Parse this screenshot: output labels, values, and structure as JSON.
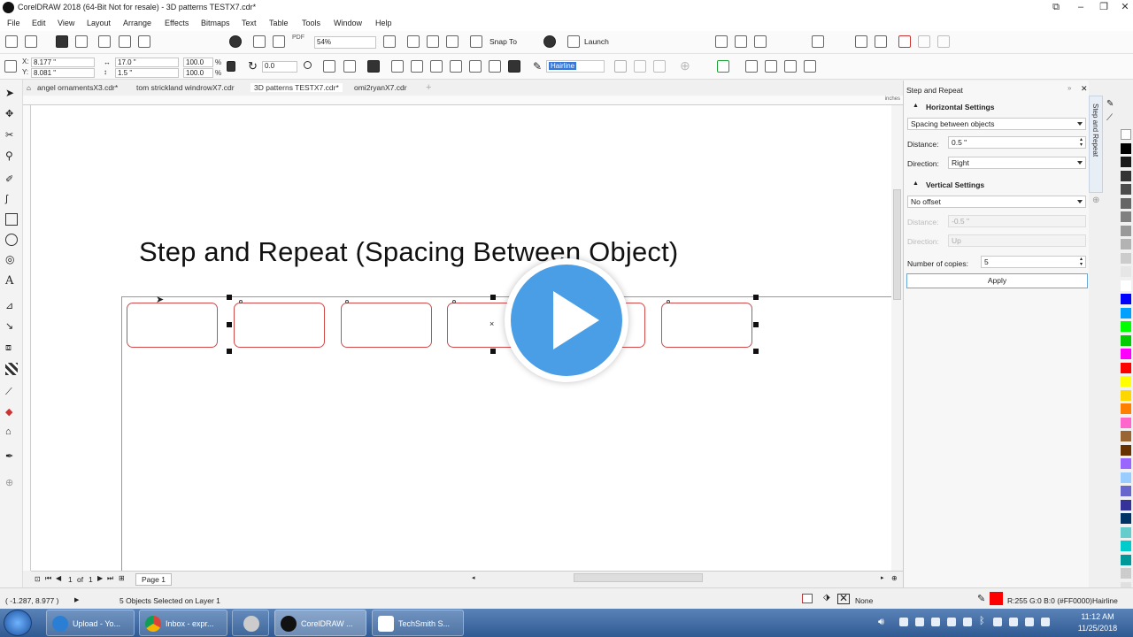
{
  "window": {
    "title": "CorelDRAW 2018 (64-Bit Not for resale) - 3D patterns TESTX7.cdr*"
  },
  "menu": [
    "File",
    "Edit",
    "View",
    "Layout",
    "Arrange",
    "Effects",
    "Bitmaps",
    "Text",
    "Table",
    "Tools",
    "Window",
    "Help"
  ],
  "toolbar": {
    "zoom": "54%",
    "snap_to": "Snap To",
    "launch": "Launch",
    "pdf": "PDF"
  },
  "propbar": {
    "x": "8.177 \"",
    "y": "8.081 \"",
    "w": "17.0 \"",
    "h": "1.5 \"",
    "scale_x": "100.0",
    "scale_y": "100.0",
    "pct": "%",
    "angle": "0.0",
    "outline": "Hairline"
  },
  "tabs": [
    "angel ornamentsX3.cdr*",
    "tom strickland windrowX7.cdr",
    "3D patterns TESTX7.cdr*",
    "omi2ryanX7.cdr"
  ],
  "ruler": {
    "unit": "inches"
  },
  "canvas": {
    "title": "Step and Repeat (Spacing Between Object)"
  },
  "docker": {
    "title": "Step and Repeat",
    "tab_label": "Step and Repeat",
    "horizontal_header": "Horizontal Settings",
    "h_mode": "Spacing between objects",
    "distance_label": "Distance:",
    "distance_value": "0.5 \"",
    "direction_label": "Direction:",
    "direction_value": "Right",
    "vertical_header": "Vertical Settings",
    "v_mode": "No offset",
    "v_distance_label": "Distance:",
    "v_distance_value": "-0.5 \"",
    "v_direction_label": "Direction:",
    "v_direction_value": "Up",
    "copies_label": "Number of copies:",
    "copies_value": "5",
    "apply": "Apply"
  },
  "page_nav": {
    "current": "1",
    "of": "of",
    "total": "1",
    "page_tab": "Page 1"
  },
  "status": {
    "coords": "( -1.287, 8.977 )",
    "selection": "5 Objects Selected on Layer 1",
    "fill": "None",
    "outline_color": "R:255 G:0 B:0 (#FF0000)",
    "outline_width": "Hairline"
  },
  "taskbar": {
    "items": [
      "Upload - Yo...",
      "Inbox - expr...",
      "CorelDRAW ...",
      "TechSmith S..."
    ],
    "time": "11:12 AM",
    "date": "11/25/2018"
  },
  "colors": {
    "accent": "#4a9ee6",
    "object_outline": "#d24a4a",
    "outline_swatch": "#ff0000",
    "palette": [
      "#ffffff",
      "#000000",
      "#1a1a1a",
      "#333333",
      "#4d4d4d",
      "#666666",
      "#808080",
      "#999999",
      "#b3b3b3",
      "#cccccc",
      "#e6e6e6",
      "#ffffff",
      "#0000ff",
      "#00a0ff",
      "#00ff00",
      "#00cc00",
      "#ff00ff",
      "#ff0000",
      "#ffff00",
      "#ffd700",
      "#ff8000",
      "#ff66cc",
      "#996633",
      "#663300",
      "#9966ff",
      "#99ccff",
      "#6666cc",
      "#333399",
      "#003366",
      "#66cccc",
      "#00cccc",
      "#009999",
      "#cccccc",
      "#e0e0e0"
    ]
  },
  "icons": [
    "play-icon",
    "pick-tool-icon",
    "zoom-tool-icon",
    "text-tool-icon",
    "rectangle-tool-icon",
    "ellipse-tool-icon",
    "fill-tool-icon"
  ]
}
